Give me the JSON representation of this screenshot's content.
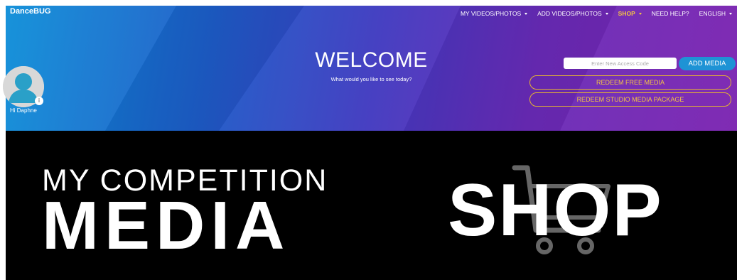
{
  "header": {
    "brand": "DanceBUG",
    "nav": [
      {
        "label": "MY VIDEOS/PHOTOS",
        "dropdown": true
      },
      {
        "label": "ADD VIDEOS/PHOTOS",
        "dropdown": true
      },
      {
        "label": "SHOP",
        "dropdown": true
      },
      {
        "label": "NEED HELP?",
        "dropdown": false
      },
      {
        "label": "ENGLISH",
        "dropdown": true
      }
    ]
  },
  "welcome": {
    "title": "WELCOME",
    "subtitle": "What would you like to see today?"
  },
  "user": {
    "greeting": "Hi Daphne",
    "badge": "i"
  },
  "access": {
    "placeholder": "Enter New Access Code",
    "add_button": "ADD MEDIA",
    "redeem_free": "REDEEM FREE MEDIA",
    "redeem_studio": "REDEEM STUDIO MEDIA PACKAGE"
  },
  "banner": {
    "left_line1": "MY COMPETITION",
    "left_line2": "MEDIA",
    "right_word": "SHOP"
  },
  "colors": {
    "accent_gold": "#f3c445",
    "button_blue": "#1e93d5",
    "banner_bg": "#000000"
  },
  "icons": [
    "avatar-silhouette-icon",
    "info-badge-icon",
    "shopping-cart-icon",
    "caret-down-icon"
  ]
}
